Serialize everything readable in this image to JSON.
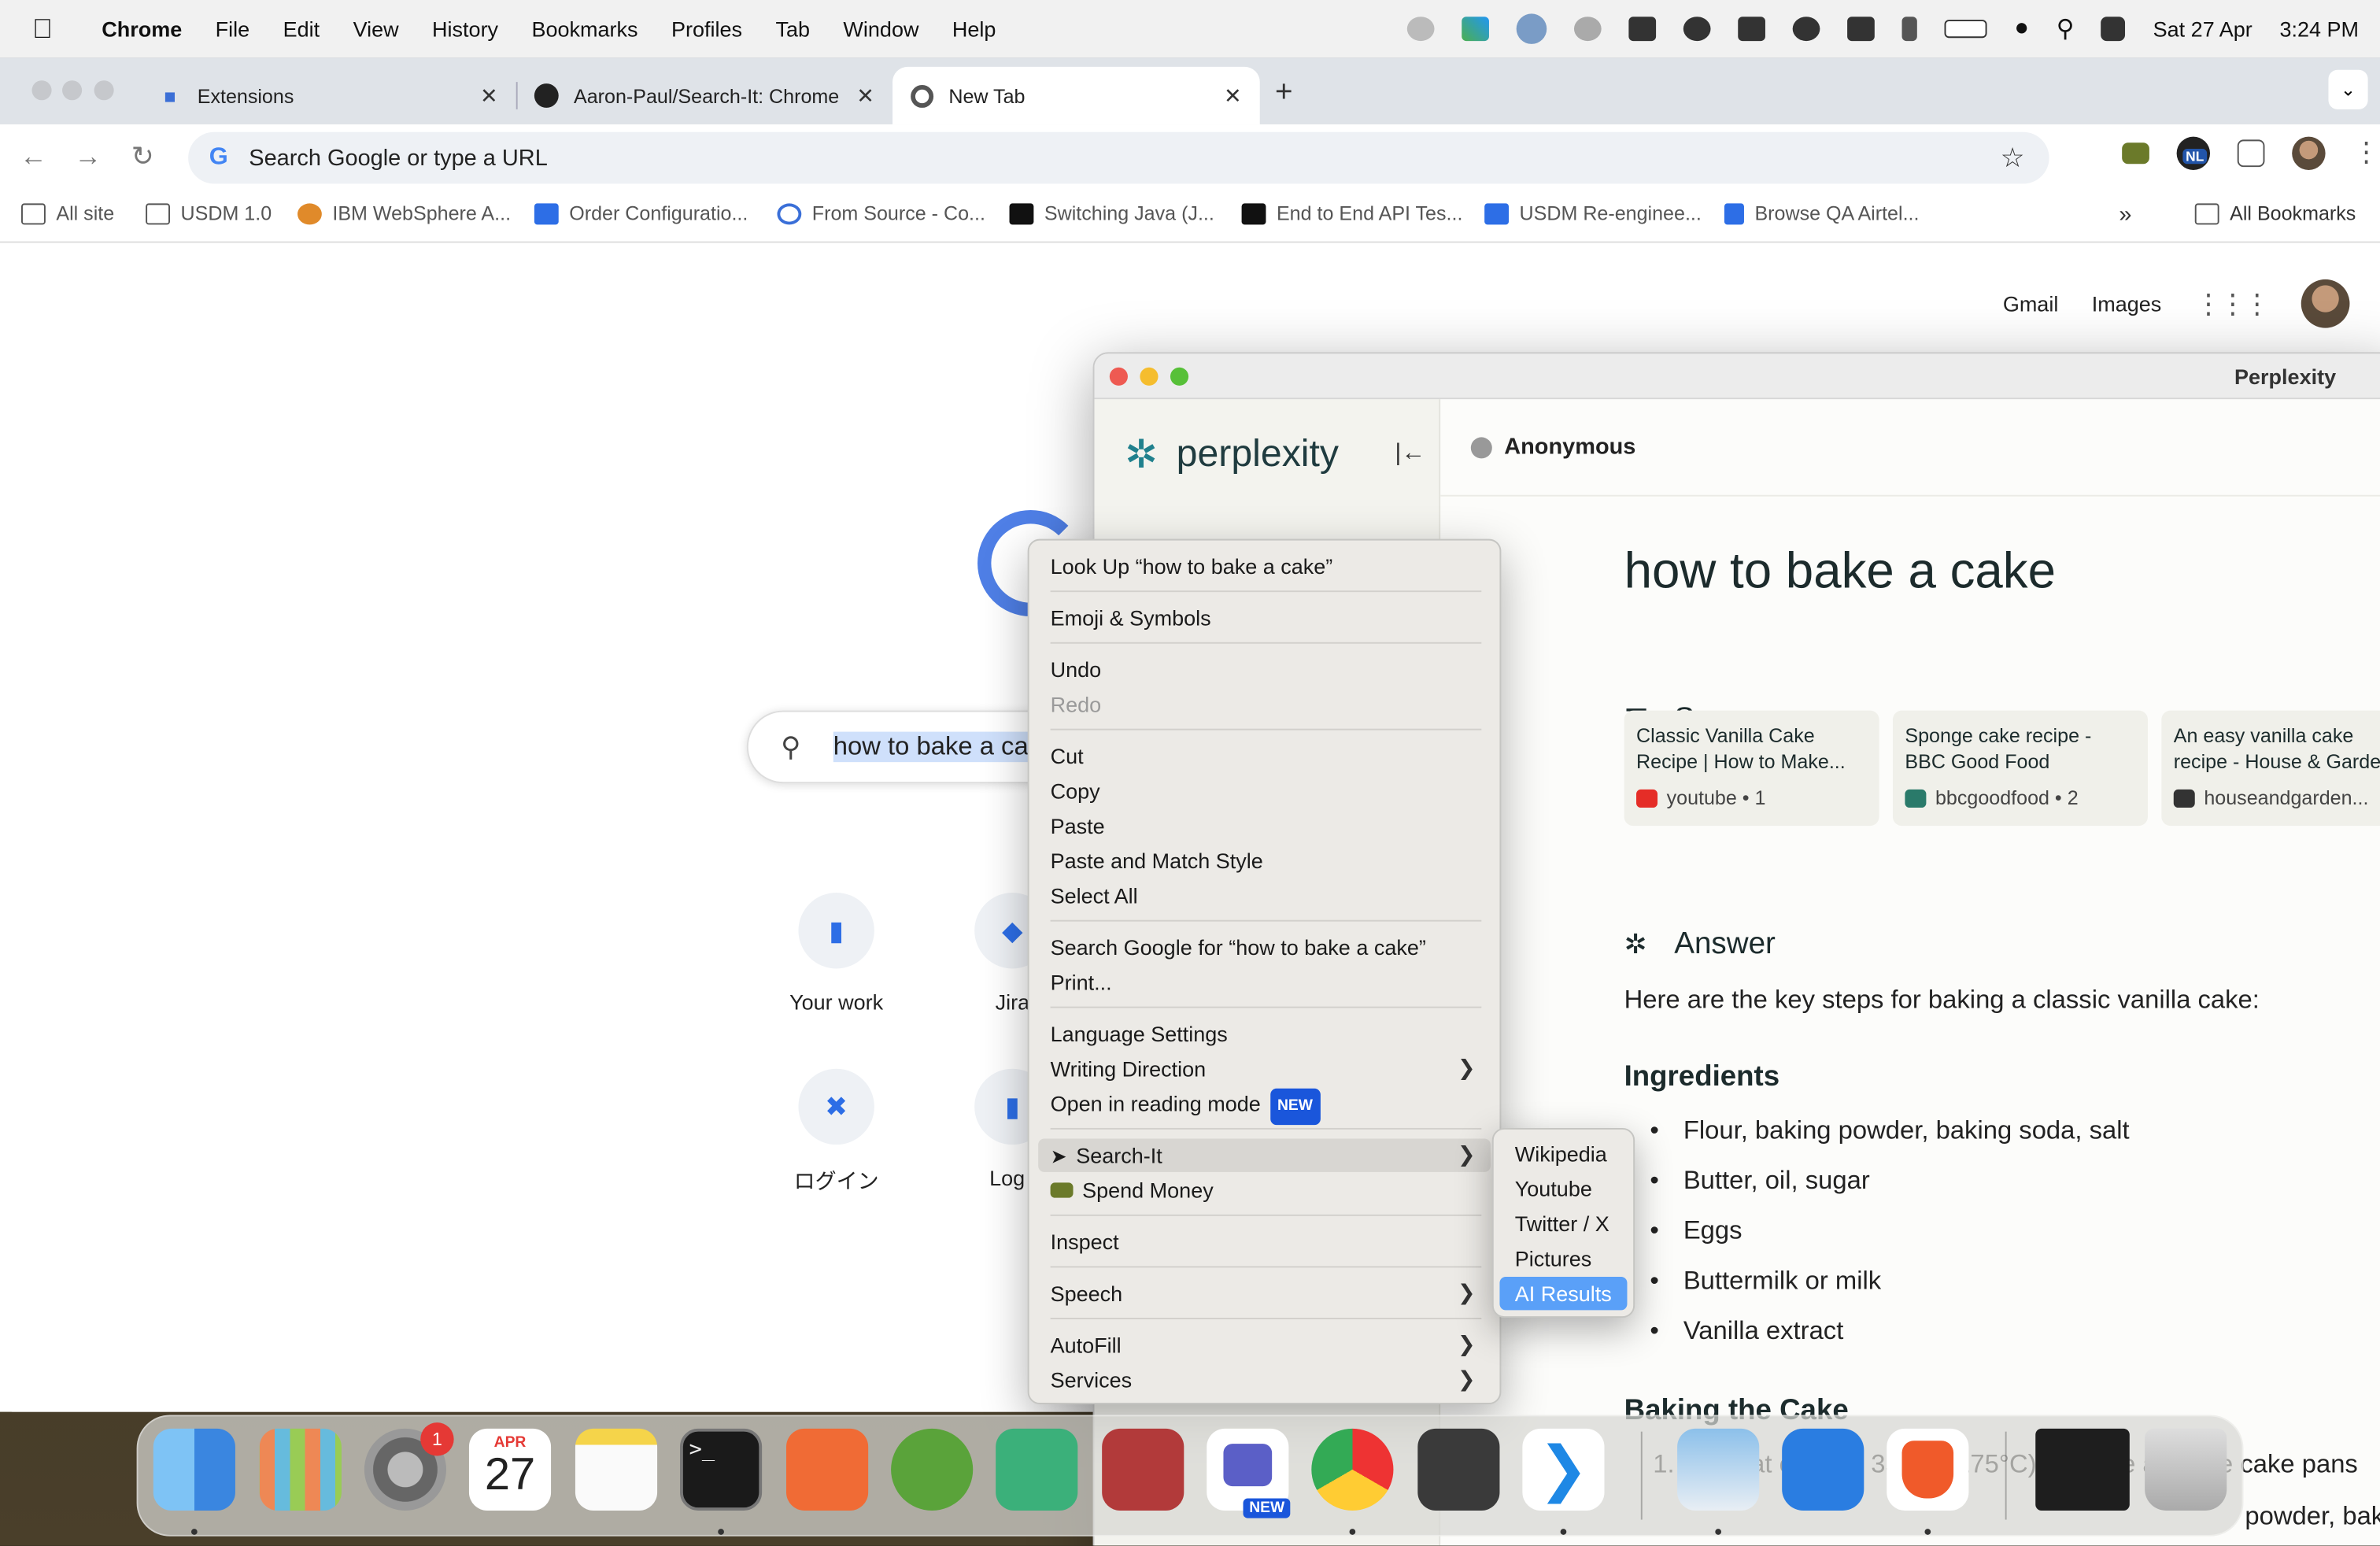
{
  "menubar": {
    "app": "Chrome",
    "items": [
      "File",
      "Edit",
      "View",
      "History",
      "Bookmarks",
      "Profiles",
      "Tab",
      "Window",
      "Help"
    ],
    "date": "Sat 27 Apr",
    "time": "3:24 PM"
  },
  "tabs": [
    {
      "title": "Extensions",
      "icon": "puzzle-icon"
    },
    {
      "title": "Aaron-Paul/Search-It: Chrome",
      "icon": "github-icon"
    },
    {
      "title": "New Tab",
      "icon": "chrome-icon"
    }
  ],
  "omnibox": {
    "placeholder": "Search Google or type a URL"
  },
  "toolbar": {
    "profile_badge": "NL"
  },
  "bookmarks": [
    {
      "label": "All site",
      "icon": "folder-icon"
    },
    {
      "label": "USDM 1.0",
      "icon": "folder-icon"
    },
    {
      "label": "IBM WebSphere A...",
      "icon": "ibm-icon"
    },
    {
      "label": "Order Configuratio...",
      "icon": "confluence-icon"
    },
    {
      "label": "From Source - Co...",
      "icon": "source-icon"
    },
    {
      "label": "Switching Java (J...",
      "icon": "medium-icon"
    },
    {
      "label": "End to End API Tes...",
      "icon": "medium-icon"
    },
    {
      "label": "USDM Re-enginee...",
      "icon": "confluence-icon"
    },
    {
      "label": "Browse QA Airtel...",
      "icon": "bitbucket-icon"
    }
  ],
  "bookmarks_more": "»",
  "all_bookmarks": "All Bookmarks",
  "google": {
    "gmail": "Gmail",
    "images": "Images",
    "search_text": "how to bake a cak",
    "shortcuts": [
      {
        "label": "Your work",
        "icon": "bitbucket-icon"
      },
      {
        "label": "Jira",
        "icon": "jira-icon"
      },
      {
        "label": "ログイン",
        "icon": "confluence-icon"
      },
      {
        "label": "Log i",
        "icon": "bitbucket-icon"
      }
    ]
  },
  "perplexity": {
    "window_title": "Perplexity",
    "logo_text": "perplexity",
    "user": "Anonymous",
    "query": "how to bake a cake",
    "sources_heading": "Sources",
    "sources": [
      {
        "title": "Classic Vanilla Cake Recipe | How to Make...",
        "site": "youtube",
        "num": "1",
        "color": "#e52d27"
      },
      {
        "title": "Sponge cake recipe - BBC Good Food",
        "site": "bbcgoodfood",
        "num": "2",
        "color": "#2a7a6a"
      },
      {
        "title": "An easy vanilla cake recipe - House & Garden",
        "site": "houseandgarden...",
        "num": "",
        "color": "#333333"
      }
    ],
    "answer_heading": "Answer",
    "answer_intro": "Here are the key steps for baking a classic vanilla cake:",
    "ingredients_heading": "Ingredients",
    "ingredients": [
      "Flour, baking powder, baking soda, salt",
      "Butter, oil, sugar",
      "Eggs",
      "Buttermilk or milk",
      "Vanilla extract"
    ],
    "baking_heading": "Baking the Cake",
    "baking_line1": "1. Preheat oven to 350°F (175°C). Grease and line cake pans",
    "baking_line2": "powder, bak"
  },
  "context_menu": {
    "lookup": "Look Up “how to bake a cake”",
    "emoji": "Emoji & Symbols",
    "undo": "Undo",
    "redo": "Redo",
    "cut": "Cut",
    "copy": "Copy",
    "paste": "Paste",
    "paste_match": "Paste and Match Style",
    "select_all": "Select All",
    "search_google": "Search Google for “how to bake a cake”",
    "print": "Print...",
    "language": "Language Settings",
    "writing_direction": "Writing Direction",
    "reading_mode": "Open in reading mode",
    "new_badge": "NEW",
    "search_it": "Search-It",
    "spend_money": "Spend Money",
    "inspect": "Inspect",
    "speech": "Speech",
    "autofill": "AutoFill",
    "services": "Services"
  },
  "submenu": {
    "items": [
      "Wikipedia",
      "Youtube",
      "Twitter / X",
      "Pictures",
      "AI Results"
    ],
    "selected": "AI Results"
  },
  "dock": {
    "calendar_month": "APR",
    "calendar_day": "27",
    "settings_badge": "1",
    "teams_badge": "NEW",
    "apps": [
      "Finder",
      "Launchpad",
      "System Settings",
      "Calendar",
      "Notes",
      "Terminal",
      "Postman",
      "Spring Tools",
      "DataGrip",
      "Helix",
      "Microsoft Teams",
      "Google Chrome",
      "Sublime Text",
      "Visual Studio Code",
      "Preview",
      "Safari",
      "Brave",
      "VS Code Window",
      "Trash"
    ]
  }
}
